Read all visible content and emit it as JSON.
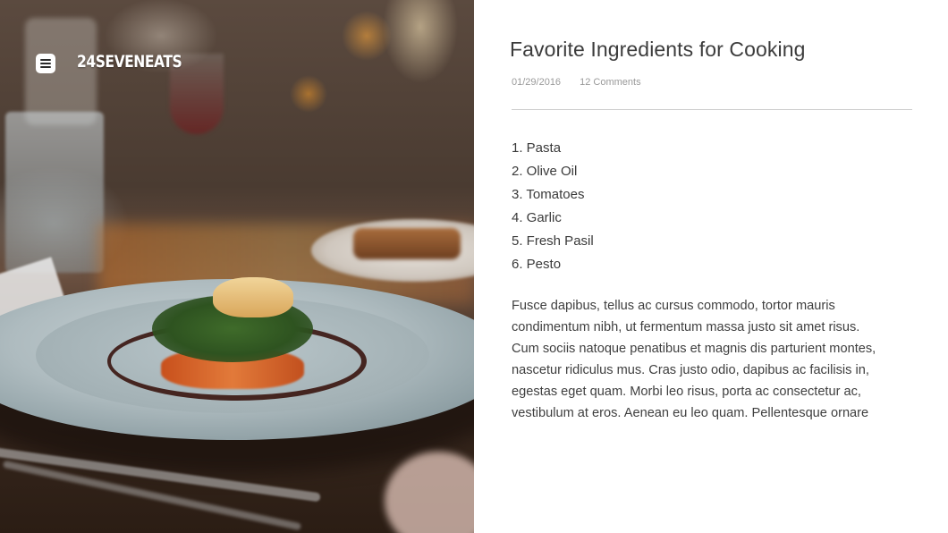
{
  "header": {
    "menu_icon": "hamburger-menu-icon",
    "brand": "24SEVENEATS"
  },
  "hero": {
    "image_subject": "plated dish photo"
  },
  "article": {
    "title": "Favorite Ingredients for Cooking",
    "date": "01/29/2016",
    "comments": "12 Comments",
    "ingredients": [
      "1. Pasta",
      "2. Olive Oil",
      "3. Tomatoes",
      "4. Garlic",
      "5. Fresh Pasil",
      "6. Pesto"
    ],
    "body_lines": [
      "Fusce dapibus, tellus ac cursus commodo, tortor mauris",
      "condimentum nibh, ut fermentum massa justo sit amet risus.",
      "Cum sociis natoque penatibus et magnis dis parturient montes,",
      "nascetur ridiculus mus. Cras justo odio, dapibus ac facilisis in,",
      "egestas eget quam. Morbi leo risus, porta ac consectetur ac,",
      "vestibulum at eros. Aenean eu leo quam. Pellentesque ornare"
    ]
  },
  "colors": {
    "title": "#3c3c3c",
    "meta": "#9a9a9a",
    "body": "#3f3f3f",
    "divider": "#cfcfcf",
    "brand": "#ffffff"
  }
}
